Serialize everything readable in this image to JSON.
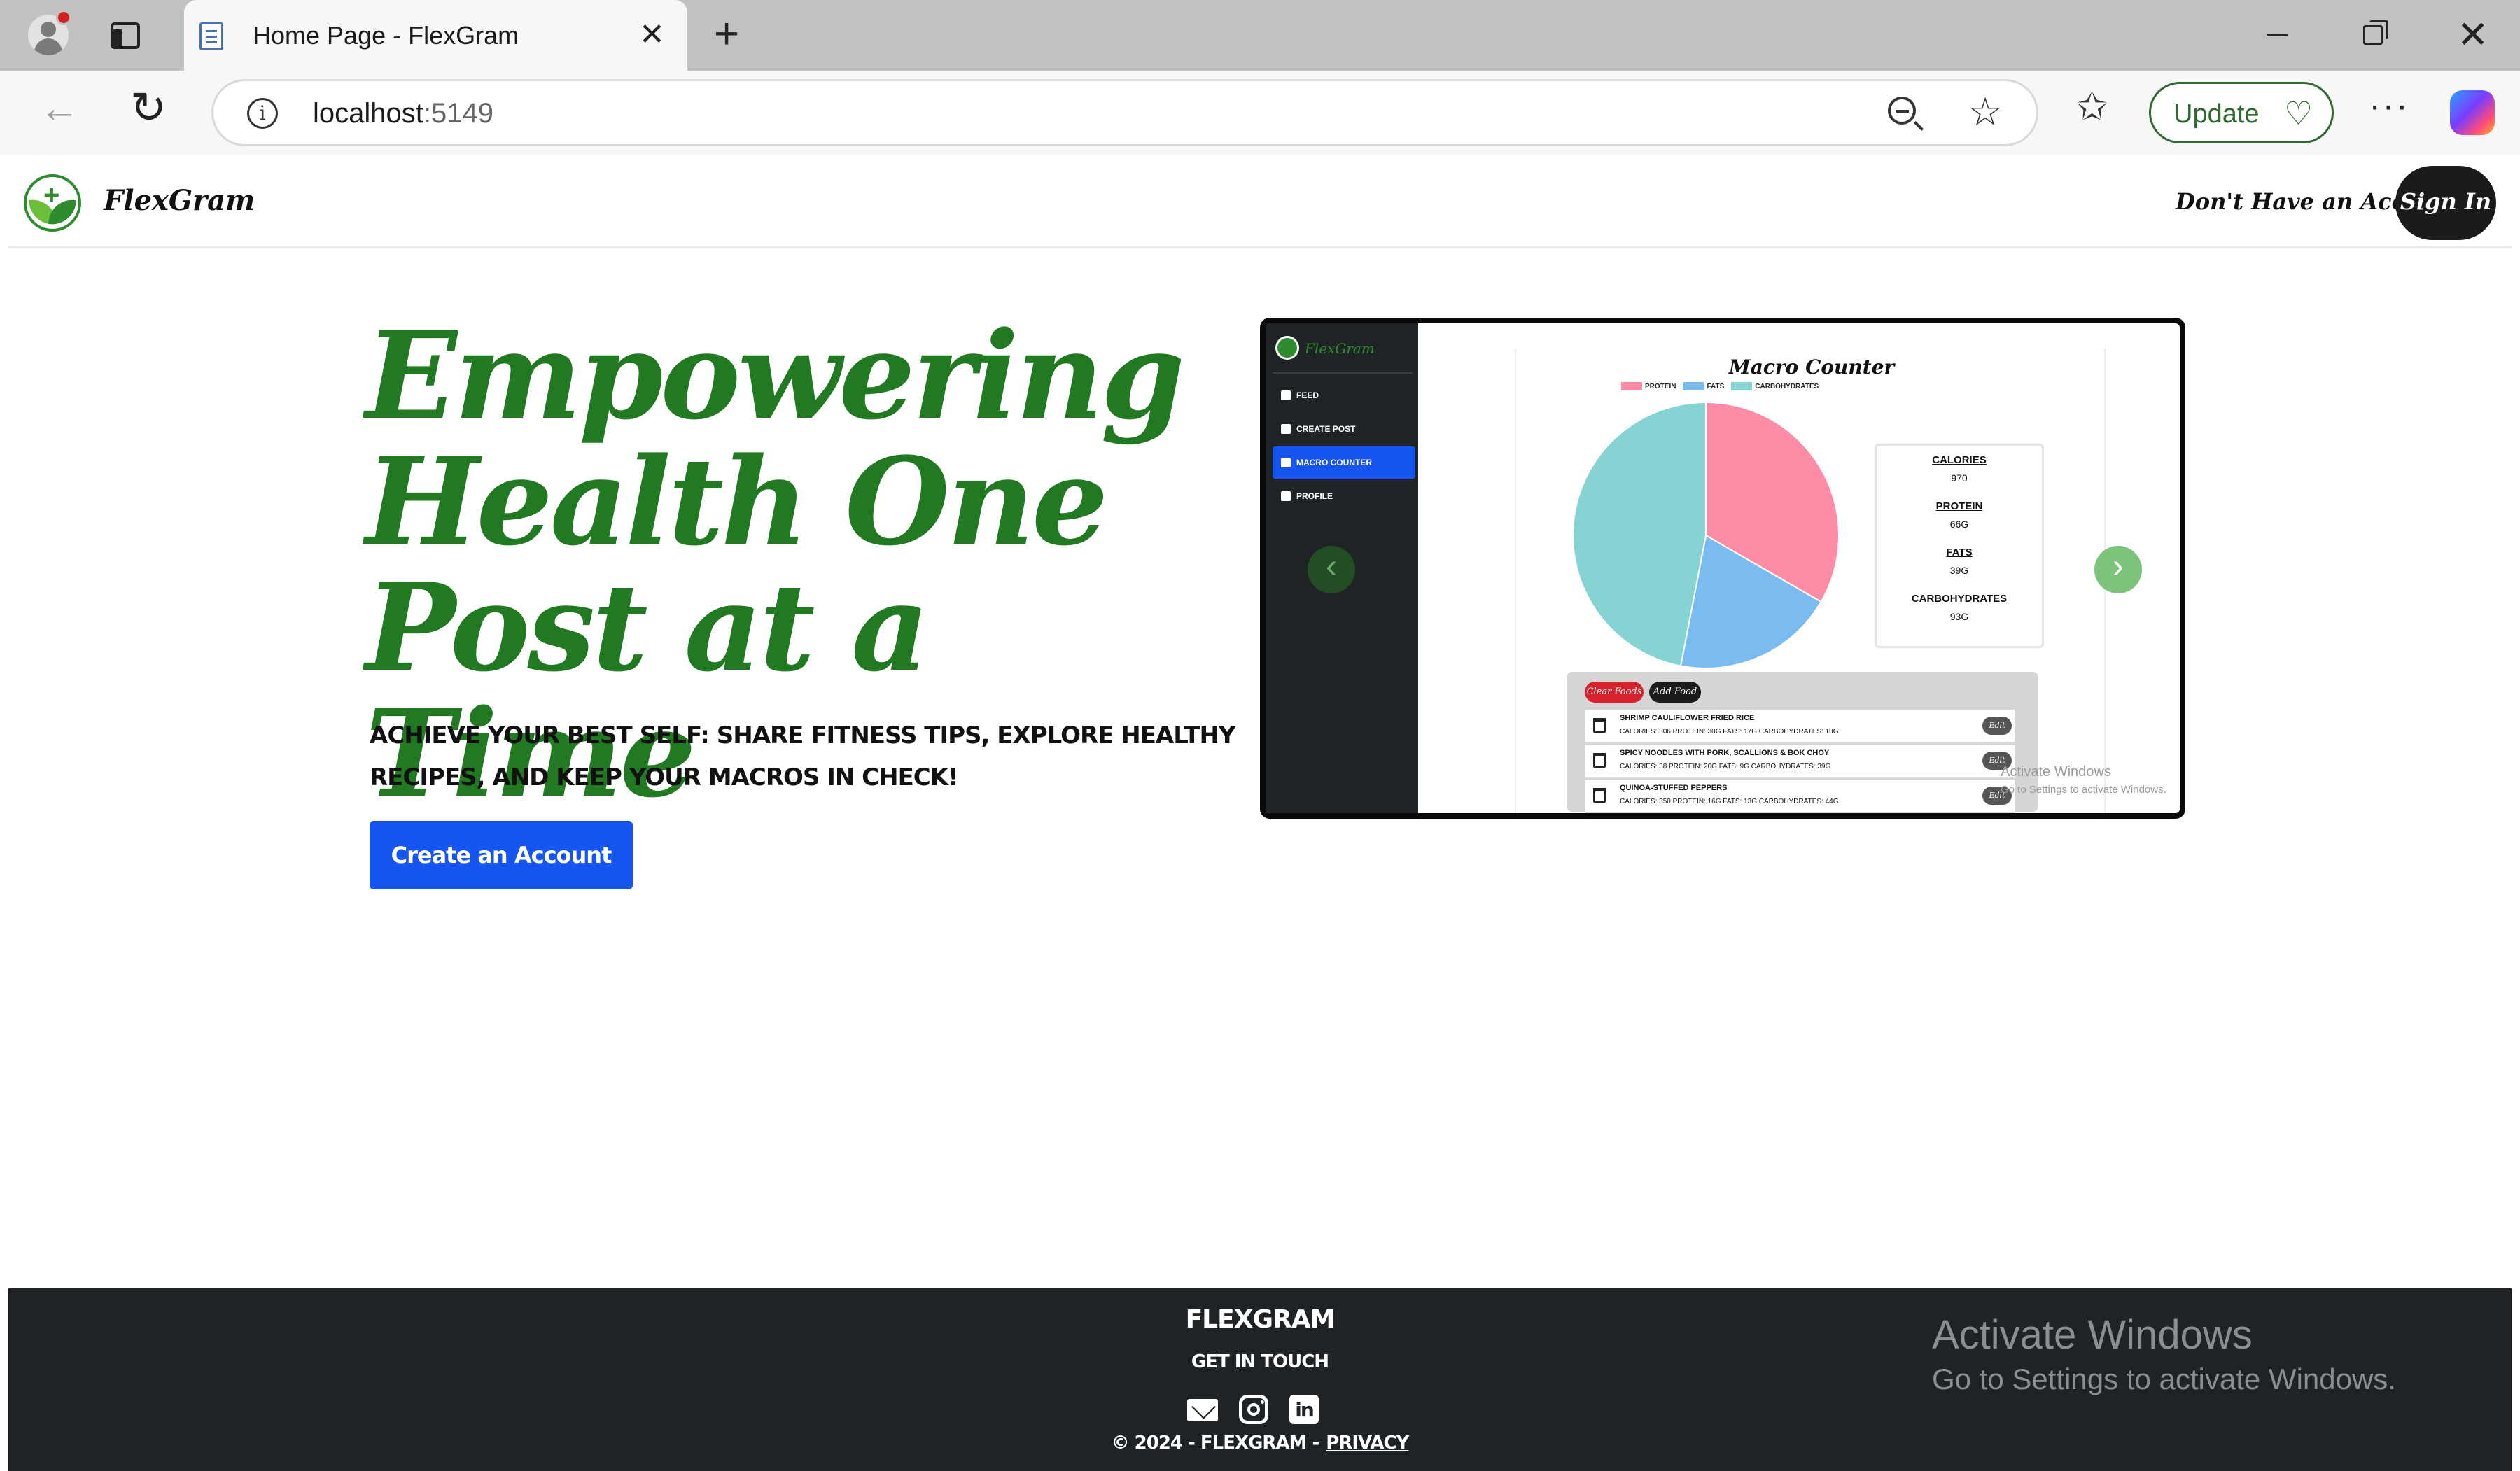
{
  "browser": {
    "tab_title": "Home Page - FlexGram",
    "url_host": "localhost",
    "url_port": ":5149",
    "update_label": "Update",
    "icons": {
      "back": "back-arrow-icon",
      "reload": "reload-icon",
      "info": "info-icon",
      "zoom": "zoom-out-icon",
      "star": "star-icon",
      "favorites": "favorites-icon",
      "more": "more-icon",
      "copilot": "copilot-icon"
    },
    "glyphs": {
      "close": "✕",
      "new_tab": "+",
      "back": "←",
      "reload": "↻",
      "info": "i",
      "star": "☆",
      "favorites": "✩",
      "update_icon": "♡",
      "more": "···",
      "win_close": "✕"
    }
  },
  "header": {
    "brand": "FlexGram",
    "no_account": "Don't Have an Account?",
    "sign_in": "Sign In"
  },
  "hero": {
    "title": "Empowering Health One Post at a Time",
    "subtitle": "Achieve your best self: Share fitness tips, explore healthy recipes, and keep your macros in check!",
    "cta": "Create an Account"
  },
  "preview": {
    "sidebar": {
      "brand": "FlexGram",
      "items": [
        {
          "label": "Feed",
          "active": false
        },
        {
          "label": "Create Post",
          "active": false
        },
        {
          "label": "Macro Counter",
          "active": true
        },
        {
          "label": "Profile",
          "active": false
        }
      ]
    },
    "arrows": {
      "prev": "‹",
      "next": "›"
    },
    "macro_counter": {
      "title": "Macro Counter",
      "legend": [
        {
          "label": "PROTEIN",
          "color": "#ff8ca6"
        },
        {
          "label": "FATS",
          "color": "#7bbcf0"
        },
        {
          "label": "CARBOHYDRATES",
          "color": "#86d3d3"
        }
      ],
      "stats": [
        {
          "label": "CALORIES",
          "value": "970"
        },
        {
          "label": "PROTEIN",
          "value": "66G"
        },
        {
          "label": "FATS",
          "value": "39G"
        },
        {
          "label": "CARBOHYDRATES",
          "value": "93G"
        }
      ],
      "clear_button": "Clear Foods",
      "add_button": "Add Food",
      "foods": [
        {
          "name": "SHRIMP CAULIFLOWER FRIED RICE",
          "macros": "CALORIES: 306 PROTEIN: 30G FATS: 17G CARBOHYDRATES: 10G",
          "edit": "Edit"
        },
        {
          "name": "SPICY NOODLES WITH PORK, SCALLIONS & BOK CHOY",
          "macros": "CALORIES: 38 PROTEIN: 20G FATS: 9G CARBOHYDRATES: 39G",
          "edit": "Edit"
        },
        {
          "name": "QUINOA-STUFFED PEPPERS",
          "macros": "CALORIES: 350 PROTEIN: 16G FATS: 13G CARBOHYDRATES: 44G",
          "edit": "Edit"
        }
      ]
    },
    "chart_data": {
      "type": "pie",
      "title": "Macro Counter",
      "categories": [
        "PROTEIN",
        "FATS",
        "CARBOHYDRATES"
      ],
      "values": [
        66,
        39,
        93
      ],
      "colors": [
        "#ff8ca6",
        "#7bbcf0",
        "#86d3d3"
      ],
      "legend": "top"
    },
    "watermark": {
      "line1": "Activate Windows",
      "line2": "Go to Settings to activate Windows."
    }
  },
  "footer": {
    "brand": "FLEXGRAM",
    "get_in_touch": "GET IN TOUCH",
    "copyright": "© 2024 - FLEXGRAM -",
    "privacy": "PRIVACY",
    "icons": [
      "mail-icon",
      "instagram-icon",
      "linkedin-icon"
    ],
    "linkedin_glyph": "in"
  },
  "os_watermark": {
    "line1": "Activate Windows",
    "line2": "Go to Settings to activate Windows."
  }
}
